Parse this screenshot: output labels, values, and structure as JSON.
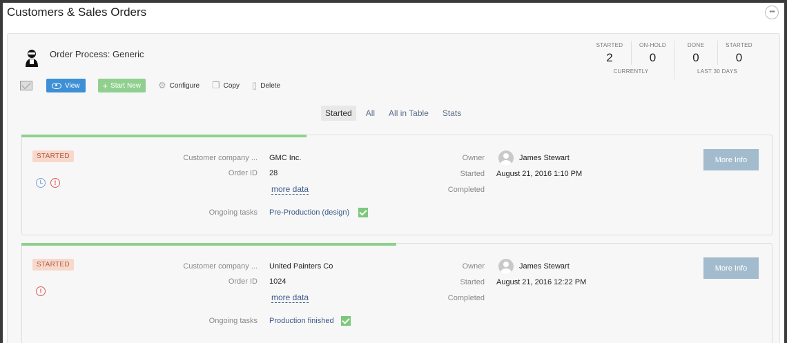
{
  "page": {
    "title": "Customers & Sales Orders"
  },
  "process": {
    "title": "Order Process: Generic",
    "stats": {
      "currently": {
        "caption": "CURRENTLY",
        "items": [
          {
            "label": "STARTED",
            "value": "2"
          },
          {
            "label": "ON-HOLD",
            "value": "0"
          }
        ]
      },
      "last30": {
        "caption": "LAST 30 DAYS",
        "items": [
          {
            "label": "DONE",
            "value": "0"
          },
          {
            "label": "STARTED",
            "value": "0"
          }
        ]
      }
    }
  },
  "toolbar": {
    "view_label": "View",
    "start_new_label": "Start New",
    "configure_label": "Configure",
    "copy_label": "Copy",
    "delete_label": "Delete"
  },
  "tabs": [
    {
      "label": "Started",
      "active": true
    },
    {
      "label": "All",
      "active": false
    },
    {
      "label": "All in Table",
      "active": false
    },
    {
      "label": "Stats",
      "active": false
    }
  ],
  "labels": {
    "customer_company": "Customer company ...",
    "order_id": "Order ID",
    "more_data": "more data",
    "ongoing_tasks": "Ongoing tasks",
    "owner": "Owner",
    "started": "Started",
    "completed": "Completed",
    "more_info": "More Info"
  },
  "orders": [
    {
      "status": "STARTED",
      "progress": 0.38,
      "customer_company": "GMC Inc.",
      "order_id": "28",
      "ongoing_task": "Pre-Production (design)",
      "owner": "James Stewart",
      "started": "August 21, 2016 1:10 PM",
      "completed": ""
    },
    {
      "status": "STARTED",
      "progress": 0.5,
      "customer_company": "United Painters Co",
      "order_id": "1024",
      "ongoing_task": "Production finished",
      "owner": "James Stewart",
      "started": "August 21, 2016 12:22 PM",
      "completed": ""
    }
  ],
  "colors": {
    "accent_blue": "#3d8fd6",
    "start_green": "#8fd08f",
    "badge_bg": "#f8d8cc",
    "more_info_bg": "#a2bccd"
  }
}
